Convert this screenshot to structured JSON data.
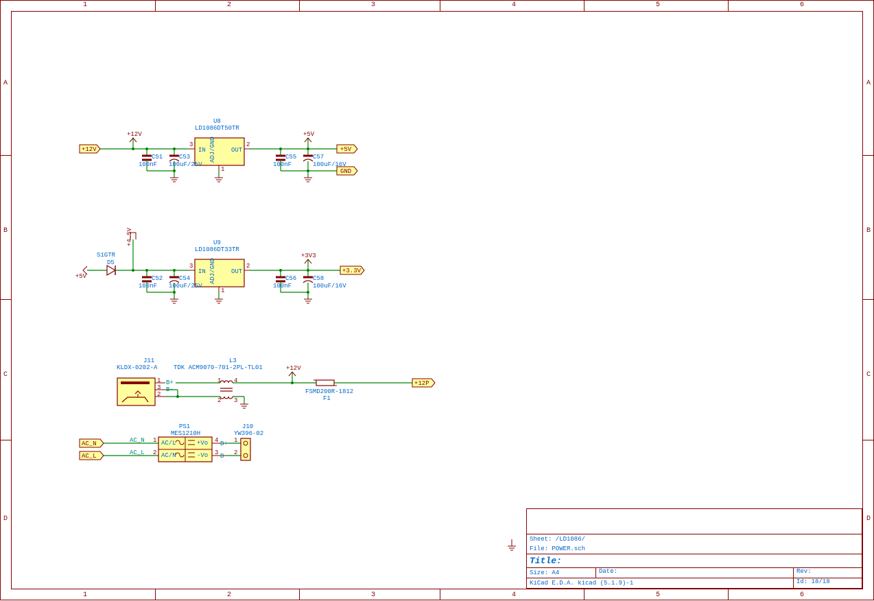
{
  "titleblock": {
    "sheet": "Sheet: /LD1086/",
    "file": "File: POWER.sch",
    "title": "Title:",
    "size": "Size: A4",
    "date": "Date:",
    "rev": "Rev:",
    "program": "KiCad E.D.A.  kicad (5.1.9)-1",
    "id": "Id: 18/18"
  },
  "border": {
    "cols": [
      "1",
      "2",
      "3",
      "4",
      "5",
      "6"
    ],
    "rows": [
      "A",
      "B",
      "C",
      "D"
    ]
  },
  "u8": {
    "ref": "U8",
    "value": "LD1086DT50TR",
    "pin_in": "IN",
    "pin_out": "OUT",
    "pin_adj": "ADJ/GND",
    "n1": "1",
    "n2": "2",
    "n3": "3"
  },
  "u9": {
    "ref": "U9",
    "value": "LD1086DT33TR",
    "pin_in": "IN",
    "pin_out": "OUT",
    "pin_adj": "ADJ/GND",
    "n1": "1",
    "n2": "2",
    "n3": "3"
  },
  "c51": {
    "ref": "C51",
    "value": "100nF"
  },
  "c52": {
    "ref": "C52",
    "value": "100nF"
  },
  "c53": {
    "ref": "C53",
    "value": "100uF/25V"
  },
  "c54": {
    "ref": "C54",
    "value": "100uF/25V"
  },
  "c55": {
    "ref": "C55",
    "value": "100nF"
  },
  "c56": {
    "ref": "C56",
    "value": "100nF"
  },
  "c57": {
    "ref": "C57",
    "value": "100uF/16V"
  },
  "c58": {
    "ref": "C58",
    "value": "100uF/16V"
  },
  "d5": {
    "ref": "D5",
    "value": "S1GTR"
  },
  "j11": {
    "ref": "J11",
    "value": "KLDX-0202-A",
    "p1": "1",
    "p2": "2",
    "p3": "3",
    "bplus": "B+",
    "bminus": "B-"
  },
  "j10": {
    "ref": "J10",
    "value": "YW396-02",
    "p1": "1",
    "p2": "2",
    "bplus": "B+",
    "bminus": "B-"
  },
  "l3": {
    "ref": "L3",
    "value": "TDK ACM9070-701-2PL-TL01",
    "p1": "1",
    "p2": "2",
    "p3": "3",
    "p4": "4"
  },
  "f1": {
    "ref": "F1",
    "value": "FSMD200R-1812"
  },
  "ps1": {
    "ref": "PS1",
    "value": "MES1210H",
    "acl": "AC/L",
    "acn": "AC/N",
    "vplus": "+Vo",
    "vminus": "-Vo",
    "p1": "1",
    "p2": "2",
    "p3": "3",
    "p4": "4",
    "acn_lbl": "AC_N",
    "acl_lbl": "AC_L"
  },
  "power": {
    "p12v": "+12V",
    "p5v": "+5V",
    "p4_5v": "+4.5V",
    "p3v3": "+3V3",
    "lbl_12v": "+12V",
    "lbl_5v": "+5V",
    "lbl_gnd": "GND",
    "lbl_3_3v": "+3.3V",
    "lbl_12p": "+12P",
    "lbl_acn": "AC_N",
    "lbl_acl": "AC_L"
  }
}
